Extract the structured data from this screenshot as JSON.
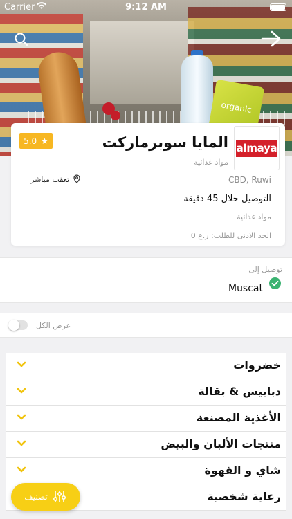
{
  "status_bar": {
    "carrier": "Carrier",
    "time": "9:12 AM"
  },
  "store": {
    "name": "المايا سوبرماركت",
    "logo_text": "almaya",
    "category": "مواد غذائية",
    "rating": "5.0",
    "location": "CBD, Ruwi",
    "track_label": "تعقب مباشر",
    "delivery_time": "التوصيل خلال 45 دقيقة",
    "category_secondary": "مواد غذائية",
    "min_order": "الحد الادنى للطلب: ر.ع 0"
  },
  "delivery": {
    "label": "توصيل إلى",
    "city": "Muscat"
  },
  "show_all": {
    "label": "عرض الكل",
    "enabled": false
  },
  "categories": [
    {
      "title": "خضروات"
    },
    {
      "title": "دبابيس & بقالة"
    },
    {
      "title": "الأغذية المصنعة"
    },
    {
      "title": "منتجات الألبان والبيض"
    },
    {
      "title": "شاي و القهوة"
    },
    {
      "title": "رعاية شخصية"
    }
  ],
  "filter_button": {
    "label": "تصنيف"
  },
  "hero": {
    "product_label": "organic"
  },
  "colors": {
    "accent": "#f7cf15",
    "rating_badge": "#f7b722",
    "check": "#3bb371",
    "logo_red": "#d4202a"
  }
}
